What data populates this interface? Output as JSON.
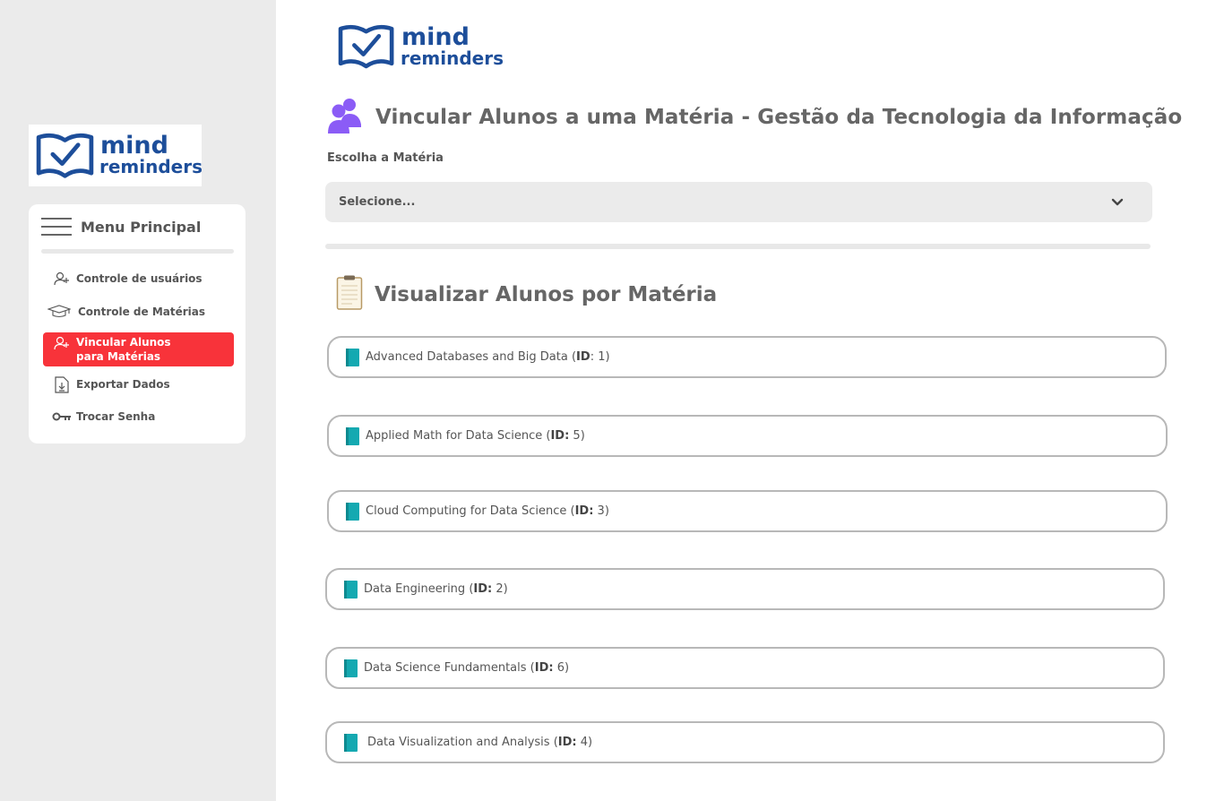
{
  "brand": {
    "word1": "mind",
    "word2": "reminders",
    "color": "#1d4e9a"
  },
  "menu": {
    "title": "Menu Principal",
    "items": [
      {
        "label": "Controle de usuários",
        "icon": "user-plus-icon",
        "active": false
      },
      {
        "label": "Controle de Matérias",
        "icon": "graduation-cap-icon",
        "active": false
      },
      {
        "label": "Vincular Alunos para Matérias",
        "icon": "user-plus-icon",
        "active": true
      },
      {
        "label": "Exportar Dados",
        "icon": "file-download-icon",
        "active": false
      },
      {
        "label": "Trocar Senha",
        "icon": "key-icon",
        "active": false
      }
    ],
    "active_color": "#f8333a"
  },
  "page": {
    "title": "Vincular Alunos a uma Matéria - Gestão da Tecnologia da Informação",
    "choose_label": "Escolha a Matéria",
    "select_placeholder": "Selecione...",
    "section_title": "Visualizar Alunos por Matéria"
  },
  "subjects": [
    {
      "name": "Advanced Databases and Big Data",
      "id_label": "ID",
      "id": "1"
    },
    {
      "name": "Applied Math for Data Science",
      "id_label": "ID:",
      "id": "5"
    },
    {
      "name": "Cloud Computing for Data Science",
      "id_label": "ID:",
      "id": "3"
    },
    {
      "name": "Data Engineering",
      "id_label": "ID:",
      "id": "2"
    },
    {
      "name": "Data Science Fundamentals",
      "id_label": "ID:",
      "id": "6"
    },
    {
      "name": "Data Visualization and Analysis",
      "id_label": "ID:",
      "id": "4"
    }
  ],
  "colors": {
    "book": "#14a9b1",
    "users_icon": "#8b5cf6"
  }
}
